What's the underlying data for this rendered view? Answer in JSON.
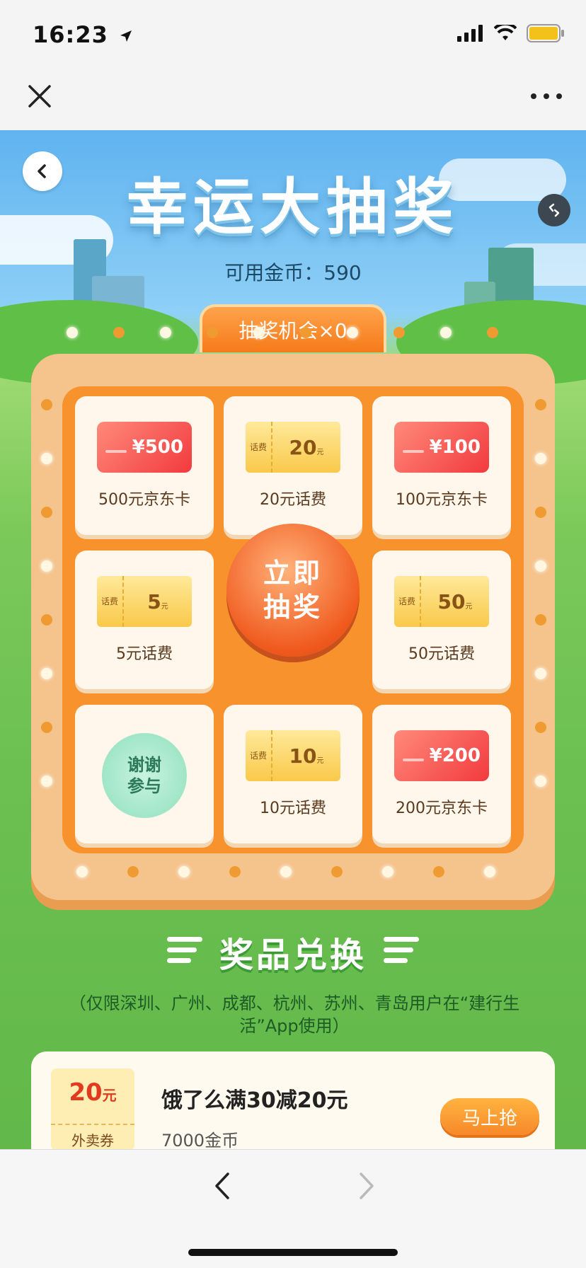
{
  "status_bar": {
    "time": "16:23"
  },
  "page": {
    "title": "幸运大抽奖",
    "coins_text": "可用金币：590",
    "chances_text": "抽奖机会×0",
    "draw_button": "立即抽奖"
  },
  "prizes": [
    {
      "label": "500元京东卡",
      "kind": "jd-card",
      "value": "¥500"
    },
    {
      "label": "20元话费",
      "kind": "ticket",
      "tag": "话费",
      "value": "20",
      "unit": "元"
    },
    {
      "label": "100元京东卡",
      "kind": "jd-card",
      "value": "¥100"
    },
    {
      "label": "5元话费",
      "kind": "ticket",
      "tag": "话费",
      "value": "5",
      "unit": "元"
    },
    {
      "label": "50元话费",
      "kind": "ticket",
      "tag": "话费",
      "value": "50",
      "unit": "元"
    },
    {
      "label": "谢谢参与",
      "kind": "thanks"
    },
    {
      "label": "10元话费",
      "kind": "ticket",
      "tag": "话费",
      "value": "10",
      "unit": "元"
    },
    {
      "label": "200元京东卡",
      "kind": "jd-card",
      "value": "¥200"
    }
  ],
  "exchange": {
    "title": "奖品兑换",
    "note": "（仅限深圳、广州、成都、杭州、苏州、青岛用户在“建行生活”App使用）",
    "coupon": {
      "amount": "20",
      "amount_unit": "元",
      "type": "外卖券",
      "name": "饿了么满30减20元",
      "cost": "7000金币",
      "button": "马上抢"
    }
  },
  "colors": {
    "accent_orange": "#f7922d",
    "sky_blue": "#5fb3f0",
    "grass_green": "#6cc052"
  },
  "icons": [
    "navigation-arrow-icon",
    "signal-icon",
    "wifi-icon",
    "battery-icon",
    "close-icon",
    "more-icon",
    "back-icon",
    "share-icon",
    "nav-back-icon",
    "nav-forward-icon"
  ]
}
